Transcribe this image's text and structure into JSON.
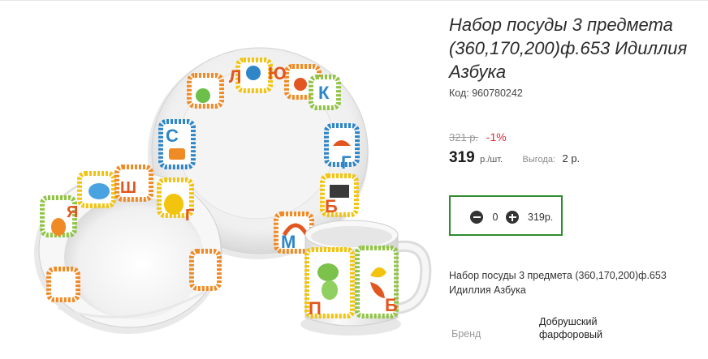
{
  "product": {
    "title": "Набор посуды 3 предмета (360,170,200)ф.653 Идиллия Азбука",
    "code_label": "Код:",
    "code_value": "960780242",
    "old_price": "321 р.",
    "discount": "-1%",
    "price": "319",
    "unit": "р./шт.",
    "savings_label": "Выгода:",
    "savings_value": "2 р.",
    "description": "Набор посуды 3 предмета (360,170,200)ф.653 Идиллия Азбука",
    "brand_label": "Бренд",
    "brand_value": "Добрушский фарфоровый"
  },
  "cart": {
    "quantity": "0",
    "total": "319р."
  },
  "image_letters": {
    "plate": [
      "Л",
      "Ю",
      "К",
      "С",
      "Г",
      "Б",
      "М",
      "Г"
    ],
    "bowl": [
      "Я",
      "Ш",
      "Г"
    ],
    "mug": [
      "П",
      "Б"
    ]
  },
  "colors": {
    "cart_border": "#2e8b2e",
    "discount": "#e02a3c"
  }
}
